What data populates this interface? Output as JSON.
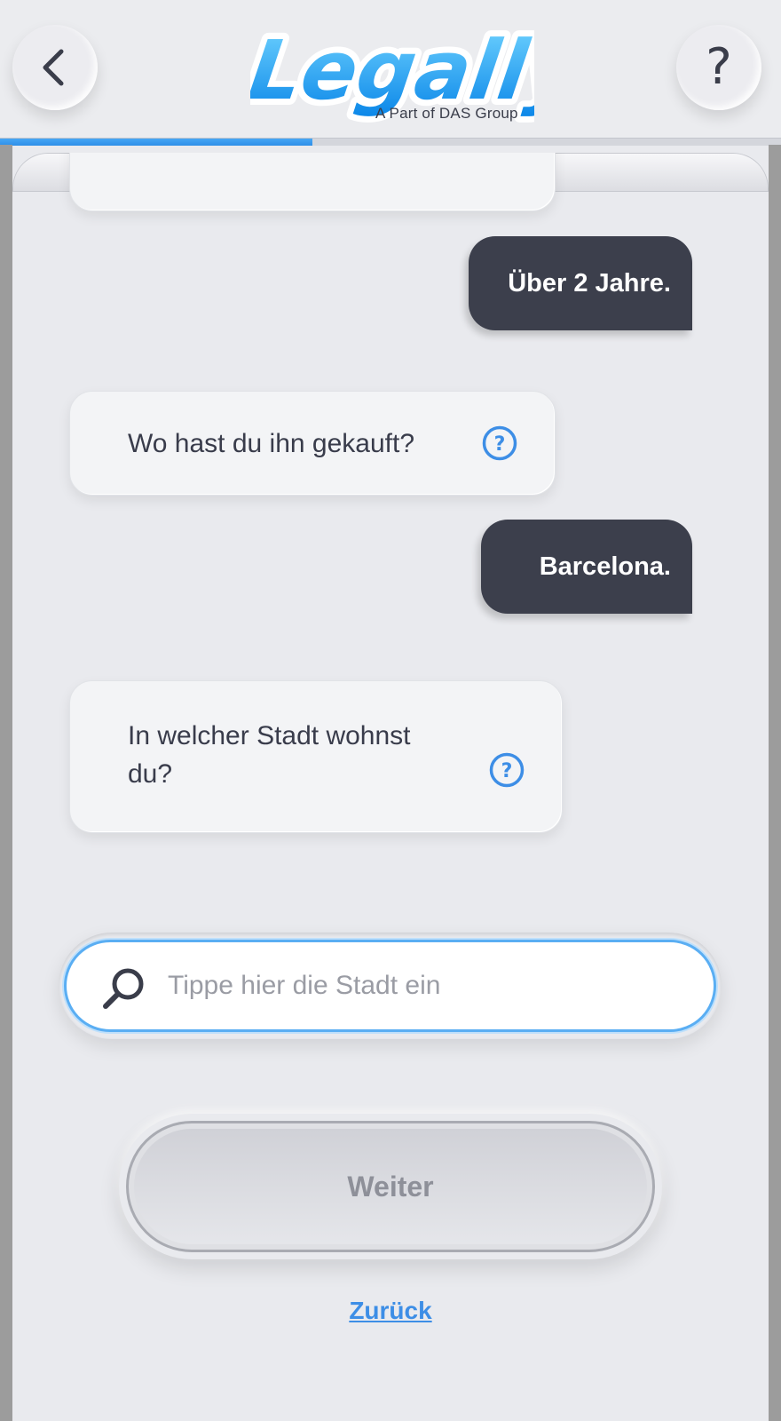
{
  "header": {
    "back_icon": "chevron-left-icon",
    "help_label": "?",
    "logo_text": "Legally",
    "logo_subtitle": "A Part of DAS Group",
    "progress_percent": 40
  },
  "chat": {
    "messages": [
      {
        "from": "user",
        "text": "Über 2 Jahre."
      },
      {
        "from": "bot",
        "text": "Wo hast du ihn gekauft?",
        "icon": "question-circle-icon"
      },
      {
        "from": "user",
        "text": "Barcelona."
      },
      {
        "from": "bot",
        "text_line1": "In welcher Stadt wohnst",
        "text_line2": "du?",
        "icon": "question-circle-icon"
      }
    ]
  },
  "search": {
    "placeholder": "Tippe hier die Stadt ein",
    "icon": "search-icon"
  },
  "actions": {
    "next_label": "Weiter",
    "back_label": "Zurück"
  },
  "colors": {
    "background": "#e9eaee",
    "user_bubble": "#3c3f4c",
    "bot_bubble": "#f3f4f6",
    "accent": "#3d8ee6",
    "progress": "#2f8fe8"
  }
}
